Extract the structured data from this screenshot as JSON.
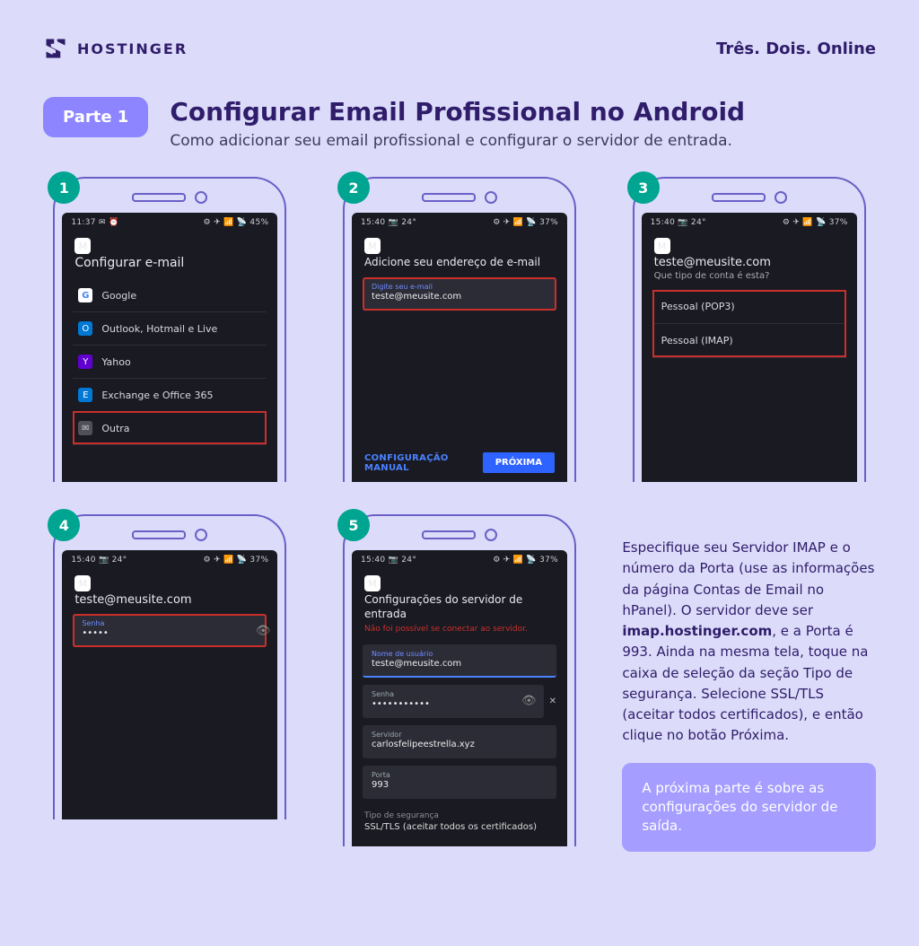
{
  "brand": {
    "name": "HOSTINGER",
    "slogan": "Três. Dois. Online"
  },
  "header": {
    "pill": "Parte 1",
    "title": "Configurar Email Profissional no Android",
    "subtitle": "Como adicionar seu email profissional e configurar o servidor de entrada."
  },
  "steps": {
    "1": {
      "num": "1",
      "status_time": "11:37",
      "status_icons": "✉ ⏰",
      "status_right": "⚙ ✈ 📶 📡 45%",
      "title": "Configurar e-mail",
      "providers": [
        {
          "name": "Google",
          "icon": "G",
          "bg": "#fff",
          "fg": "#4285f4"
        },
        {
          "name": "Outlook, Hotmail e Live",
          "icon": "O",
          "bg": "#0078d4",
          "fg": "#fff"
        },
        {
          "name": "Yahoo",
          "icon": "Y",
          "bg": "#6001d2",
          "fg": "#fff"
        },
        {
          "name": "Exchange e Office 365",
          "icon": "E",
          "bg": "#0078d4",
          "fg": "#fff"
        },
        {
          "name": "Outra",
          "icon": "✉",
          "bg": "#505058",
          "fg": "#ccc",
          "highlight": true
        }
      ]
    },
    "2": {
      "num": "2",
      "status_time": "15:40",
      "status_icons": "📷 24°",
      "status_right": "⚙ ✈ 📶 📡 37%",
      "title": "Adicione seu endereço de e-mail",
      "field_label": "Digite seu e-mail",
      "field_value": "teste@meusite.com",
      "manual": "CONFIGURAÇÃO MANUAL",
      "next": "PRÓXIMA"
    },
    "3": {
      "num": "3",
      "status_time": "15:40",
      "status_icons": "📷 24°",
      "status_right": "⚙ ✈ 📶 📡 37%",
      "title": "teste@meusite.com",
      "subtitle": "Que tipo de conta é esta?",
      "options": [
        "Pessoal (POP3)",
        "Pessoal (IMAP)"
      ]
    },
    "4": {
      "num": "4",
      "status_time": "15:40",
      "status_icons": "📷 24°",
      "status_right": "⚙ ✈ 📶 📡 37%",
      "title": "teste@meusite.com",
      "pwd_label": "Senha",
      "pwd_value": "•••••"
    },
    "5": {
      "num": "5",
      "status_time": "15:40",
      "status_icons": "📷 24°",
      "status_right": "⚙ ✈ 📶 📡 37%",
      "title": "Configurações do servidor de entrada",
      "error": "Não foi possível se conectar ao servidor.",
      "f_user_label": "Nome de usuário",
      "f_user_value": "teste@meusite.com",
      "f_pwd_label": "Senha",
      "f_pwd_value": "•••••••••••",
      "f_srv_label": "Servidor",
      "f_srv_value": "carlosfelipeestrella.xyz",
      "f_port_label": "Porta",
      "f_port_value": "993",
      "sec_label": "Tipo de segurança",
      "sec_value": "SSL/TLS (aceitar todos os certificados)"
    }
  },
  "explain": {
    "text_a": "Especifique seu Servidor IMAP e o número da Porta (use as informações da página Contas de Email no hPanel). O servidor deve ser ",
    "bold": "imap.hostinger.com",
    "text_b": ", e a Porta é 993. Ainda na mesma tela, toque na caixa de seleção da seção Tipo de segurança. Selecione SSL/TLS (aceitar todos certificados), e então clique no botão Próxima.",
    "callout": "A próxima parte é sobre as configurações do servidor de saída."
  }
}
